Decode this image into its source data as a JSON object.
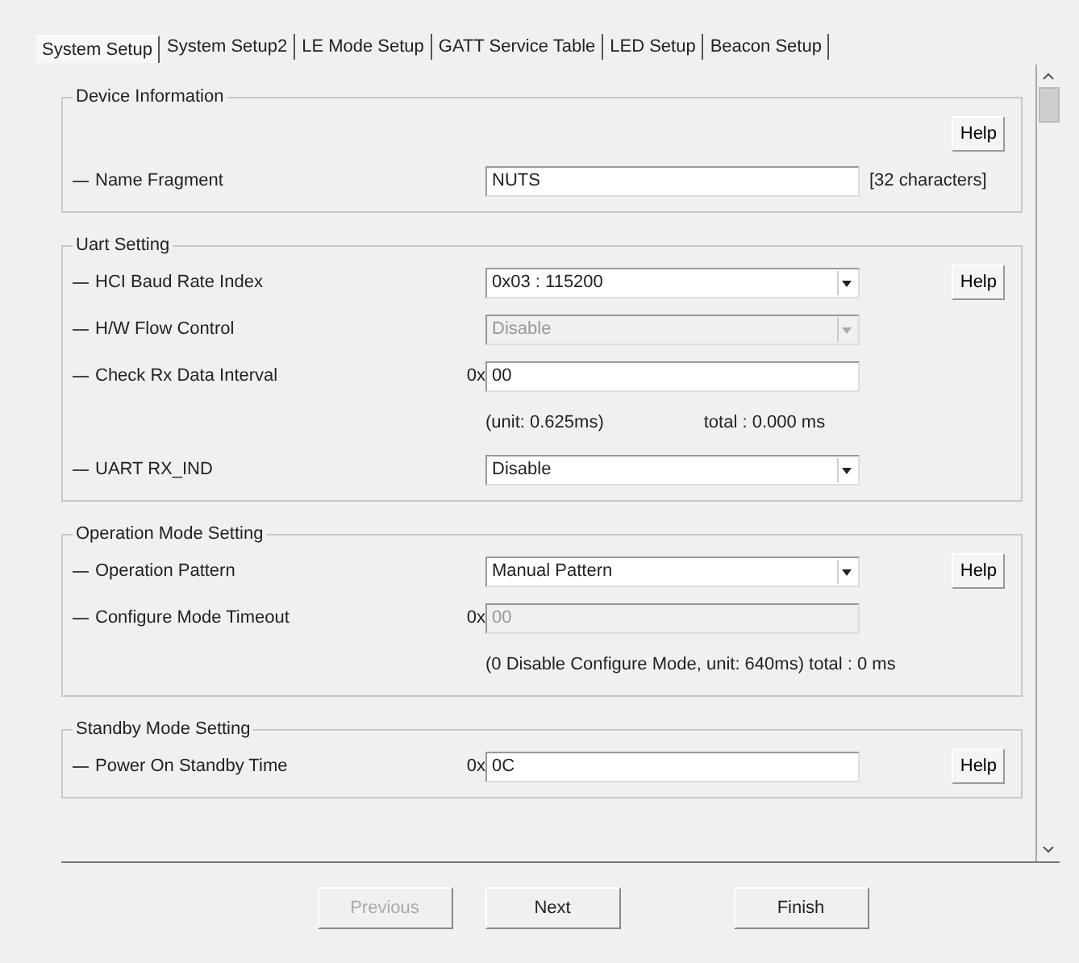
{
  "tabs": [
    {
      "label": "System Setup",
      "selected": true
    },
    {
      "label": "System Setup2",
      "selected": false
    },
    {
      "label": "LE Mode Setup",
      "selected": false
    },
    {
      "label": "GATT Service Table",
      "selected": false
    },
    {
      "label": "LED Setup",
      "selected": false
    },
    {
      "label": "Beacon Setup",
      "selected": false
    }
  ],
  "groups": [
    {
      "title": "Device Information",
      "rows": [
        {
          "kind": "help",
          "help": "Help"
        },
        {
          "kind": "text",
          "label": "Name Fragment",
          "value": "NUTS",
          "suffix": "[32 characters]",
          "disabled": false
        }
      ]
    },
    {
      "title": "Uart Setting",
      "rows": [
        {
          "kind": "dropdown",
          "label": "HCI Baud Rate Index",
          "value": "0x03 : 115200",
          "disabled": false,
          "help": "Help"
        },
        {
          "kind": "dropdown",
          "label": "H/W Flow Control",
          "value": "Disable",
          "disabled": true
        },
        {
          "kind": "text",
          "label": "Check Rx Data Interval",
          "prefix": "0x",
          "value": "00",
          "disabled": false
        },
        {
          "kind": "note",
          "notes": [
            "(unit: 0.625ms)",
            "total : 0.000 ms"
          ]
        },
        {
          "kind": "dropdown",
          "label": "UART RX_IND",
          "value": "Disable",
          "disabled": false
        }
      ]
    },
    {
      "title": "Operation Mode Setting",
      "rows": [
        {
          "kind": "dropdown",
          "label": "Operation Pattern",
          "value": "Manual Pattern",
          "disabled": false,
          "help": "Help"
        },
        {
          "kind": "text",
          "label": "Configure Mode Timeout",
          "prefix": "0x",
          "value": "00",
          "disabled": true
        },
        {
          "kind": "note",
          "notes": [
            "(0 Disable Configure Mode, unit: 640ms) total : 0 ms"
          ]
        }
      ]
    },
    {
      "title": "Standby Mode Setting",
      "rows": [
        {
          "kind": "text",
          "label": "Power On Standby Time",
          "prefix": "0x",
          "value": "0C",
          "disabled": false,
          "help": "Help"
        }
      ]
    }
  ],
  "buttons": [
    {
      "label": "Previous",
      "disabled": true
    },
    {
      "label": "Next",
      "disabled": false
    },
    {
      "label": "Finish",
      "disabled": false
    }
  ]
}
